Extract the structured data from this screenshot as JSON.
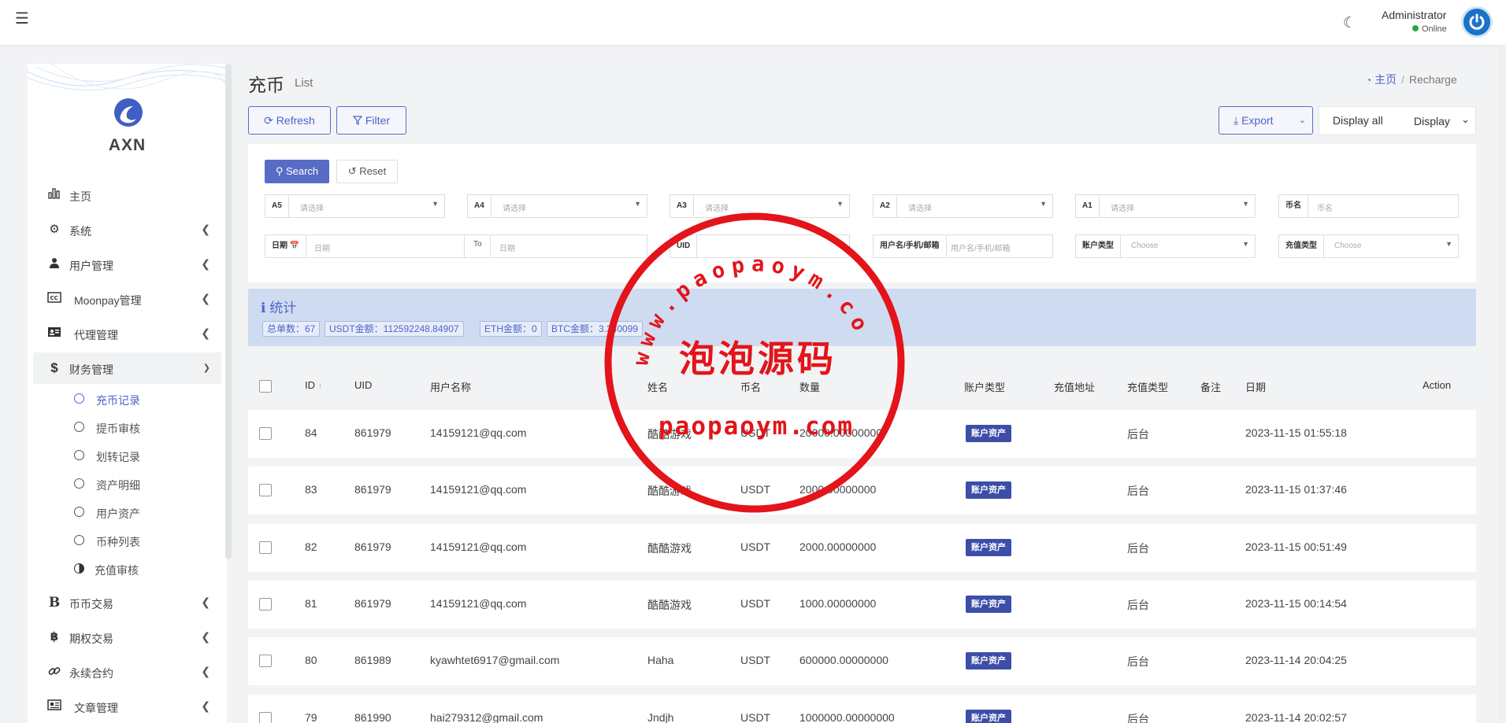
{
  "header": {
    "user_name": "Administrator",
    "user_status": "Online"
  },
  "sidebar": {
    "logo_text": "AXN",
    "items": [
      {
        "label": "主页",
        "icon": "bar-chart-icon"
      },
      {
        "label": "系统",
        "icon": "gear-icon"
      },
      {
        "label": "用户管理",
        "icon": "users-icon"
      },
      {
        "label": "Moonpay管理",
        "icon": "cc-icon"
      },
      {
        "label": "代理管理",
        "icon": "id-card-icon"
      },
      {
        "label": "财务管理",
        "icon": "dollar-icon"
      }
    ],
    "sub_items": [
      {
        "label": "充币记录"
      },
      {
        "label": "提币审核"
      },
      {
        "label": "划转记录"
      },
      {
        "label": "资产明细"
      },
      {
        "label": "用户资产"
      },
      {
        "label": "币种列表"
      },
      {
        "label": "充值审核"
      }
    ],
    "items_bottom": [
      {
        "label": "币币交易",
        "icon": "bitcoin-b-icon"
      },
      {
        "label": "期权交易",
        "icon": "bitcoin-icon"
      },
      {
        "label": "永续合约",
        "icon": "link-icon"
      },
      {
        "label": "文章管理",
        "icon": "newspaper-icon"
      }
    ]
  },
  "page": {
    "title": "充币",
    "subtitle": "List",
    "breadcrumb_home": "主页",
    "breadcrumb_sep": "/",
    "breadcrumb_current": "Recharge"
  },
  "toolbar": {
    "refresh_label": "Refresh",
    "filter_label": "Filter",
    "export_label": "Export",
    "display_all_label": "Display all",
    "display_label": "Display"
  },
  "filters": {
    "search_label": "Search",
    "reset_label": "Reset",
    "a5_label": "A5",
    "a5_placeholder": "请选择",
    "a4_label": "A4",
    "a4_placeholder": "请选择",
    "a3_label": "A3",
    "a3_placeholder": "请选择",
    "a2_label": "A2",
    "a2_placeholder": "请选择",
    "a1_label": "A1",
    "a1_placeholder": "请选择",
    "coin_label": "币名",
    "coin_placeholder": "币名",
    "date_label": "日期",
    "date_placeholder": "日期",
    "to_label": "To",
    "to_placeholder": "日期",
    "uid_label": "UID",
    "account_label": "用户名/手机/邮箱",
    "account_placeholder": "用户名/手机/邮箱",
    "acct_type_label": "账户类型",
    "acct_type_placeholder": "Choose",
    "recharge_type_label": "充值类型",
    "recharge_type_placeholder": "Choose"
  },
  "stats": {
    "title": "统计",
    "total": "总单数：67",
    "usdt": "USDT金额：112592248.84907",
    "eth": "ETH金额：0",
    "btc": "BTC金额：3.340099"
  },
  "table": {
    "columns": [
      "ID",
      "UID",
      "用户名称",
      "姓名",
      "币名",
      "数量",
      "账户类型",
      "充值地址",
      "充值类型",
      "备注",
      "日期",
      "Action"
    ],
    "rows": [
      {
        "id": "84",
        "uid": "861979",
        "user": "14159121@qq.com",
        "name": "酷酷游戏",
        "coin": "USDT",
        "amount": "20000.00000000",
        "acct_type": "账户资产",
        "recharge_type": "后台",
        "date": "2023-11-15 01:55:18"
      },
      {
        "id": "83",
        "uid": "861979",
        "user": "14159121@qq.com",
        "name": "酷酷游戏",
        "coin": "USDT",
        "amount": "2000.00000000",
        "acct_type": "账户资产",
        "recharge_type": "后台",
        "date": "2023-11-15 01:37:46"
      },
      {
        "id": "82",
        "uid": "861979",
        "user": "14159121@qq.com",
        "name": "酷酷游戏",
        "coin": "USDT",
        "amount": "2000.00000000",
        "acct_type": "账户资产",
        "recharge_type": "后台",
        "date": "2023-11-15 00:51:49"
      },
      {
        "id": "81",
        "uid": "861979",
        "user": "14159121@qq.com",
        "name": "酷酷游戏",
        "coin": "USDT",
        "amount": "1000.00000000",
        "acct_type": "账户资产",
        "recharge_type": "后台",
        "date": "2023-11-15 00:14:54"
      },
      {
        "id": "80",
        "uid": "861989",
        "user": "kyawhtet6917@gmail.com",
        "name": "Haha",
        "coin": "USDT",
        "amount": "600000.00000000",
        "acct_type": "账户资产",
        "recharge_type": "后台",
        "date": "2023-11-14 20:04:25"
      },
      {
        "id": "79",
        "uid": "861990",
        "user": "hai279312@gmail.com",
        "name": "Jndjh",
        "coin": "USDT",
        "amount": "1000000.00000000",
        "acct_type": "账户资产",
        "recharge_type": "后台",
        "date": "2023-11-14 20:02:57"
      }
    ]
  },
  "watermark": {
    "arc_text": "www.paopaoym.com",
    "center_text": "泡泡源码",
    "bottom_text": "paopaoym.com"
  },
  "colors": {
    "accent": "#586cc6",
    "stamp_red": "#e3141a",
    "badge": "#3d4ea8",
    "stats_bg": "#cfdbf0"
  }
}
